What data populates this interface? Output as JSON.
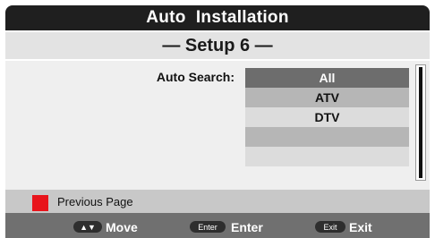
{
  "header": {
    "title": "Auto  Installation"
  },
  "setup": {
    "title": "— Setup 6 —"
  },
  "auto_search": {
    "label": "Auto Search:",
    "options": [
      "All",
      "ATV",
      "DTV",
      "",
      ""
    ],
    "selected": "All"
  },
  "previous": {
    "label": "Previous Page",
    "color": "#e8141b"
  },
  "footer": {
    "move_key": "▲▼",
    "move_label": "Move",
    "enter_key": "Enter",
    "enter_label": "Enter",
    "exit_key": "Exit",
    "exit_label": "Exit"
  }
}
